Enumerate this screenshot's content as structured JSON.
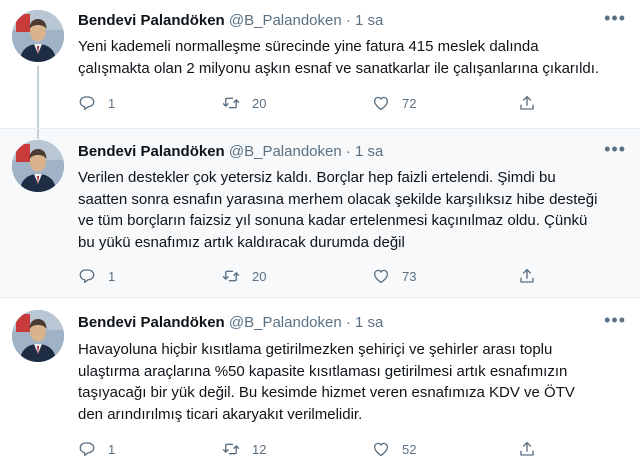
{
  "tweets": [
    {
      "author": "Bendevi Palandöken",
      "handle": "@B_Palandoken",
      "separator": "·",
      "time": "1 sa",
      "text_lines": [
        "Yeni kademeli normalleşme sürecinde yine fatura 415 meslek dalında",
        "çalışmakta olan 2 milyonu aşkın esnaf ve sanatkarlar ile çalışanlarına çıkarıldı."
      ],
      "replies": "1",
      "retweets": "20",
      "likes": "72"
    },
    {
      "author": "Bendevi Palandöken",
      "handle": "@B_Palandoken",
      "separator": "·",
      "time": "1 sa",
      "text_lines": [
        "Verilen destekler çok yetersiz kaldı. Borçlar hep faizli ertelendi. Şimdi bu",
        "saatten sonra esnafın yarasına merhem olacak şekilde karşılıksız hibe desteği",
        "ve tüm borçların faizsiz yıl sonuna kadar ertelenmesi kaçınılmaz oldu. Çünkü",
        "bu yükü esnafımız artık kaldıracak durumda değil"
      ],
      "replies": "1",
      "retweets": "20",
      "likes": "73"
    },
    {
      "author": "Bendevi Palandöken",
      "handle": "@B_Palandoken",
      "separator": "·",
      "time": "1 sa",
      "text_lines": [
        "Havayoluna hiçbir kısıtlama getirilmezken şehiriçi ve şehirler arası toplu",
        "ulaştırma araçlarına %50 kapasite kısıtlaması getirilmesi artık esnafımızın",
        "taşıyacağı bir yük değil. Bu kesimde hizmet veren esnafımıza KDV ve ÖTV",
        "den arındırılmış ticari akaryakıt verilmelidir."
      ],
      "replies": "1",
      "retweets": "12",
      "likes": "52"
    }
  ],
  "icons": {
    "reply": "reply-icon",
    "retweet": "retweet-icon",
    "like": "like-icon",
    "share": "share-icon",
    "more": "more-icon"
  },
  "colors": {
    "text": "#0f1419",
    "secondary": "#5b7083",
    "highlight_bg": "#f7f9fa",
    "thread_line": "#c4cfd6"
  }
}
